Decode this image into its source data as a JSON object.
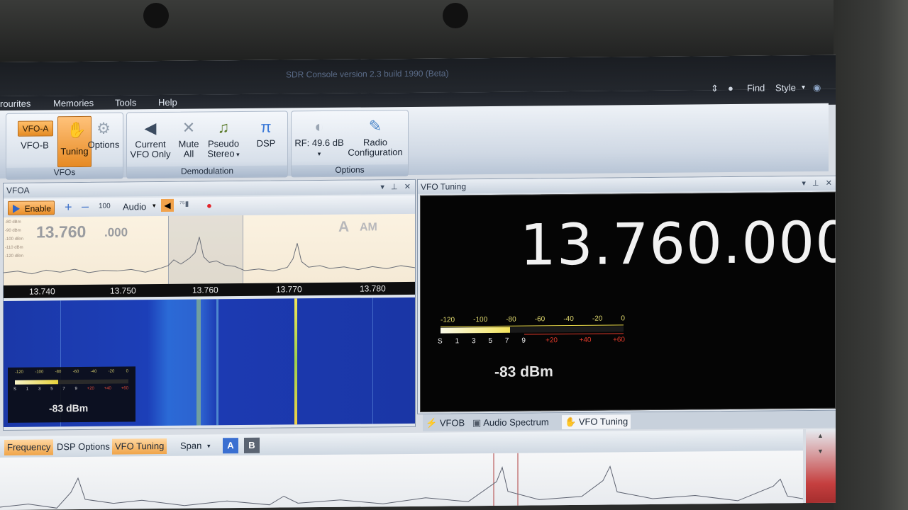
{
  "app": {
    "title": "SDR Console version 2.3 build 1990 (Beta)"
  },
  "menu": {
    "items": [
      "rourites",
      "Memories",
      "Tools",
      "Help"
    ],
    "find": "Find",
    "style": "Style"
  },
  "ribbon": {
    "vfos": {
      "vfo_a": "VFO-A",
      "vfo_b": "VFO-B",
      "tuning": "Tuning",
      "options": "Options",
      "group": "VFOs"
    },
    "demod": {
      "current_vfo_1": "Current",
      "current_vfo_2": "VFO Only",
      "mute_1": "Mute",
      "mute_2": "All",
      "pseudo_1": "Pseudo",
      "pseudo_2": "Stereo",
      "dsp": "DSP",
      "group": "Demodulation"
    },
    "options": {
      "rf": "RF: 49.6 dB",
      "radio_1": "Radio",
      "radio_2": "Configuration",
      "group": "Options"
    }
  },
  "vfoa_panel": {
    "title": "VFOA",
    "enable": "Enable",
    "step": "100",
    "audio": "Audio",
    "frequency_main": "13.760",
    "frequency_sub": ".000",
    "mode_letter": "A",
    "mode": "AM",
    "scale": [
      "13.740",
      "13.750",
      "13.760",
      "13.770",
      "13.780"
    ],
    "db_labels": [
      "-80 dBm",
      "-90 dBm",
      "-100 dBm",
      "-110 dBm",
      "-120 dBm"
    ],
    "mini_dbm": "-83 dBm",
    "mini_scale_top": [
      "-120",
      "-100",
      "-80",
      "-60",
      "-40",
      "-20",
      "0"
    ],
    "mini_scale_bottom": [
      "S",
      "1",
      "3",
      "5",
      "7",
      "9",
      "+20",
      "+40",
      "+60"
    ]
  },
  "vfo_tuning": {
    "title": "VFO Tuning",
    "frequency": "13.760.000",
    "meter_top": [
      "-120",
      "-100",
      "-80",
      "-60",
      "-40",
      "-20",
      "0"
    ],
    "meter_bottom_s": [
      "S",
      "1",
      "3",
      "5",
      "7",
      "9"
    ],
    "meter_bottom_plus": [
      "+20",
      "+40",
      "+60"
    ],
    "dbm": "-83 dBm",
    "signal_fraction": 0.38
  },
  "tabs": {
    "vfob": "VFOB",
    "audio_spectrum": "Audio Spectrum",
    "vfo_tuning": "VFO Tuning"
  },
  "bottom_bar": {
    "frequency": "Frequency",
    "dsp_options": "DSP Options",
    "vfo_tuning": "VFO Tuning",
    "span": "Span",
    "a": "A",
    "b": "B"
  },
  "colors": {
    "accent_orange": "#e8902a",
    "waterfall_blue": "#1c3fb8",
    "meter_yellow": "#f3e35a",
    "meter_red": "#e23a2a"
  }
}
